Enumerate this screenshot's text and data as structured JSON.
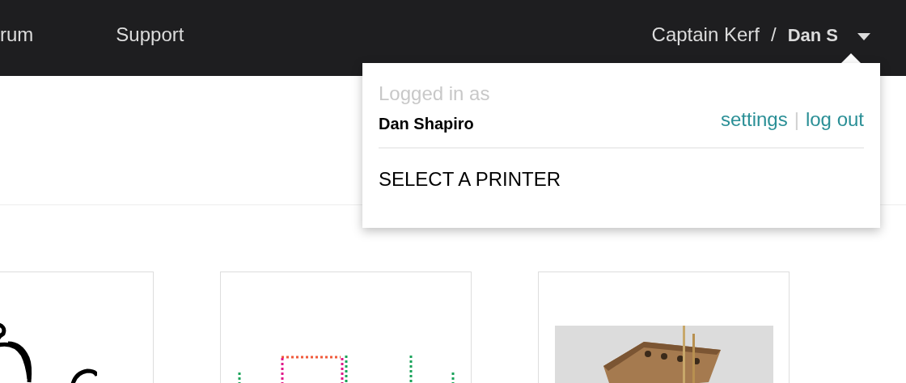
{
  "nav": [
    {
      "label": "rum"
    },
    {
      "label": "Support"
    }
  ],
  "account": {
    "team": "Captain Kerf",
    "separator": "/",
    "user": "Dan S"
  },
  "dropdown": {
    "heading": "Logged in as",
    "name": "Dan Shapiro",
    "links": [
      "settings",
      "log out"
    ],
    "link_separator": "|",
    "menu_items": [
      "SELECT A PRINTER"
    ]
  },
  "cards": [
    {
      "kind": "line-art"
    },
    {
      "kind": "dotted-design"
    },
    {
      "kind": "picture"
    }
  ]
}
